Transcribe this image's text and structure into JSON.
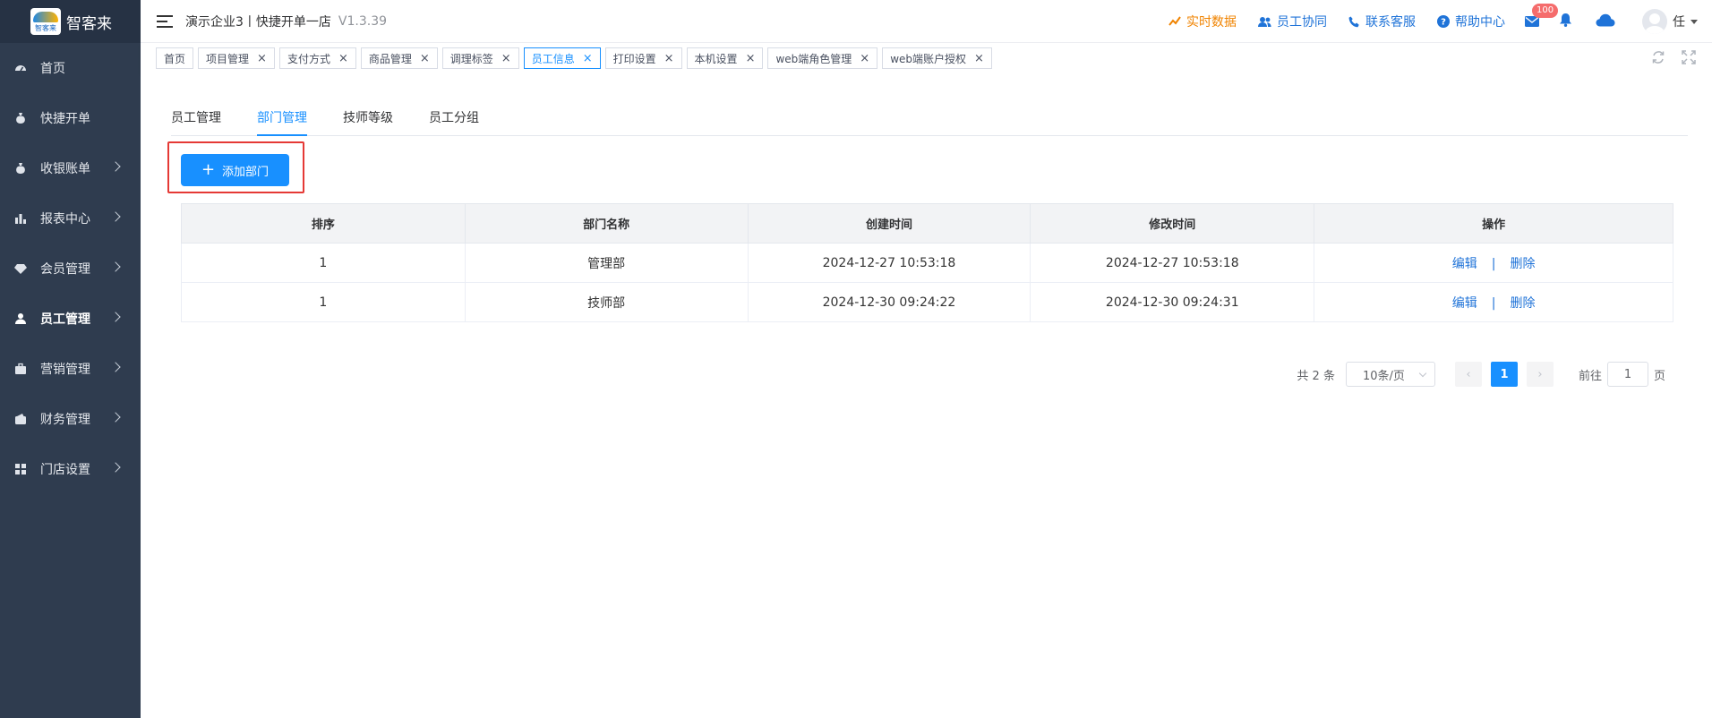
{
  "app": {
    "logo_text": "智客来",
    "logo_badge_text": "智客来"
  },
  "header": {
    "store_title": "演示企业3丨快捷开单一店",
    "version": "V1.3.39",
    "links": [
      {
        "label": "实时数据",
        "icon": "trend-icon",
        "color": "#f08300"
      },
      {
        "label": "员工协同",
        "icon": "users-icon",
        "color": "#1f73d8"
      },
      {
        "label": "联系客服",
        "icon": "phone-icon",
        "color": "#1f73d8"
      },
      {
        "label": "帮助中心",
        "icon": "help-icon",
        "color": "#1f73d8"
      }
    ],
    "mail_badge": "100",
    "user_name": "任"
  },
  "sidebar": {
    "items": [
      {
        "label": "首页",
        "icon": "dashboard-icon",
        "has_chevron": false
      },
      {
        "label": "快捷开单",
        "icon": "money-bag-icon",
        "has_chevron": false
      },
      {
        "label": "收银账单",
        "icon": "money-bag-icon",
        "has_chevron": true
      },
      {
        "label": "报表中心",
        "icon": "bar-chart-icon",
        "has_chevron": true
      },
      {
        "label": "会员管理",
        "icon": "diamond-icon",
        "has_chevron": true
      },
      {
        "label": "员工管理",
        "icon": "user-icon",
        "has_chevron": true,
        "active": true
      },
      {
        "label": "营销管理",
        "icon": "briefcase-icon",
        "has_chevron": true
      },
      {
        "label": "财务管理",
        "icon": "wallet-icon",
        "has_chevron": true
      },
      {
        "label": "门店设置",
        "icon": "grid-icon",
        "has_chevron": true
      }
    ]
  },
  "page_tabs": [
    {
      "label": "首页",
      "closable": false
    },
    {
      "label": "项目管理",
      "closable": true
    },
    {
      "label": "支付方式",
      "closable": true
    },
    {
      "label": "商品管理",
      "closable": true
    },
    {
      "label": "调理标签",
      "closable": true
    },
    {
      "label": "员工信息",
      "closable": true,
      "active": true
    },
    {
      "label": "打印设置",
      "closable": true
    },
    {
      "label": "本机设置",
      "closable": true
    },
    {
      "label": "web端角色管理",
      "closable": true
    },
    {
      "label": "web端账户授权",
      "closable": true
    }
  ],
  "sub_tabs": [
    {
      "label": "员工管理"
    },
    {
      "label": "部门管理",
      "active": true
    },
    {
      "label": "技师等级"
    },
    {
      "label": "员工分组"
    }
  ],
  "add_button_label": "添加部门",
  "table": {
    "columns": [
      "排序",
      "部门名称",
      "创建时间",
      "修改时间",
      "操作"
    ],
    "rows": [
      {
        "order": "1",
        "name": "管理部",
        "created": "2024-12-27 10:53:18",
        "modified": "2024-12-27 10:53:18"
      },
      {
        "order": "1",
        "name": "技师部",
        "created": "2024-12-30 09:24:22",
        "modified": "2024-12-30 09:24:31"
      }
    ],
    "edit_label": "编辑",
    "op_separator": "|",
    "delete_label": "删除"
  },
  "pagination": {
    "total_text": "共 2 条",
    "page_size": "10条/页",
    "current_page": "1",
    "goto_prefix": "前往",
    "goto_value": "1",
    "goto_suffix": "页"
  },
  "colors": {
    "sidebar_bg": "#2f3c4f",
    "primary": "#1890ff",
    "highlight": "#e53935",
    "orange": "#f08300"
  }
}
